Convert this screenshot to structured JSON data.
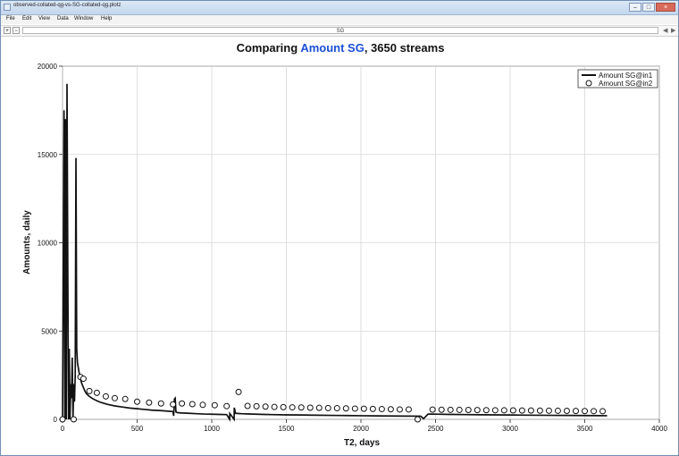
{
  "window": {
    "title": "observed-collated-qg-vs-SG-collated-qg.plotz"
  },
  "menu": [
    "File",
    "Edit",
    "View",
    "Data",
    "Window",
    "Help"
  ],
  "toolbar": {
    "tab_name": "SG",
    "left_control_plus": "+",
    "left_control_minus": "−"
  },
  "chart_data": {
    "type": "line",
    "title_prefix": "Comparing ",
    "title_highlight": "Amount SG",
    "title_suffix": ", 3650 streams",
    "title_highlight_color": "#1a4fd6",
    "xlabel": "T2, days",
    "ylabel": "Amounts, daily",
    "xlim": [
      0,
      4000
    ],
    "ylim": [
      0,
      20000
    ],
    "x_ticks": [
      0,
      500,
      1000,
      1500,
      2000,
      2500,
      3000,
      3500,
      4000
    ],
    "y_ticks": [
      0,
      5000,
      10000,
      15000,
      20000
    ],
    "grid": true,
    "legend_position": "top-right",
    "series": [
      {
        "name": "Amount SG@in1",
        "style": "line",
        "color": "#111111",
        "x": [
          0,
          10,
          15,
          20,
          25,
          30,
          35,
          40,
          45,
          50,
          55,
          60,
          65,
          70,
          75,
          80,
          85,
          90,
          95,
          100,
          110,
          120,
          130,
          140,
          150,
          160,
          180,
          200,
          230,
          260,
          300,
          350,
          400,
          450,
          500,
          550,
          600,
          650,
          700,
          740,
          745,
          750,
          755,
          760,
          770,
          800,
          850,
          900,
          950,
          1000,
          1050,
          1100,
          1120,
          1121,
          1150,
          1151,
          1160,
          1180,
          1200,
          1250,
          1300,
          1350,
          1400,
          1500,
          1600,
          1700,
          1800,
          1900,
          2000,
          2100,
          2200,
          2300,
          2400,
          2420,
          2450,
          2500,
          2600,
          2700,
          2800,
          2900,
          3000,
          3100,
          3200,
          3300,
          3400,
          3500,
          3600,
          3650
        ],
        "y": [
          0,
          17500,
          0,
          17000,
          0,
          19000,
          9000,
          0,
          4000,
          0,
          2000,
          1200,
          3500,
          0,
          2000,
          1000,
          2500,
          14800,
          4000,
          3200,
          2700,
          2300,
          2000,
          1800,
          1600,
          1450,
          1300,
          1180,
          1050,
          950,
          850,
          760,
          700,
          640,
          600,
          560,
          520,
          500,
          470,
          440,
          200,
          1150,
          1200,
          420,
          380,
          360,
          340,
          320,
          300,
          290,
          280,
          270,
          0,
          330,
          0,
          660,
          340,
          330,
          320,
          305,
          290,
          280,
          270,
          255,
          245,
          235,
          225,
          215,
          205,
          198,
          190,
          185,
          180,
          40,
          300,
          295,
          280,
          270,
          260,
          252,
          245,
          238,
          230,
          225,
          220,
          215,
          210,
          205
        ]
      },
      {
        "name": "Amount SG@in2",
        "style": "markers",
        "color": "#111111",
        "x": [
          0,
          75,
          120,
          140,
          180,
          230,
          290,
          350,
          420,
          500,
          580,
          660,
          740,
          800,
          870,
          940,
          1020,
          1100,
          1180,
          1240,
          1300,
          1360,
          1420,
          1480,
          1540,
          1600,
          1660,
          1720,
          1780,
          1840,
          1900,
          1960,
          2020,
          2080,
          2140,
          2200,
          2260,
          2320,
          2380,
          2480,
          2540,
          2600,
          2660,
          2720,
          2780,
          2840,
          2900,
          2960,
          3020,
          3080,
          3140,
          3200,
          3260,
          3320,
          3380,
          3440,
          3500,
          3560,
          3620
        ],
        "y": [
          0,
          0,
          2400,
          2300,
          1600,
          1500,
          1300,
          1200,
          1150,
          1000,
          950,
          900,
          850,
          900,
          860,
          820,
          800,
          750,
          1550,
          760,
          740,
          720,
          700,
          690,
          680,
          670,
          660,
          650,
          640,
          630,
          620,
          610,
          600,
          590,
          580,
          570,
          560,
          560,
          0,
          550,
          545,
          540,
          535,
          530,
          525,
          520,
          515,
          510,
          505,
          500,
          500,
          495,
          490,
          485,
          480,
          475,
          470,
          465,
          460
        ]
      }
    ]
  }
}
